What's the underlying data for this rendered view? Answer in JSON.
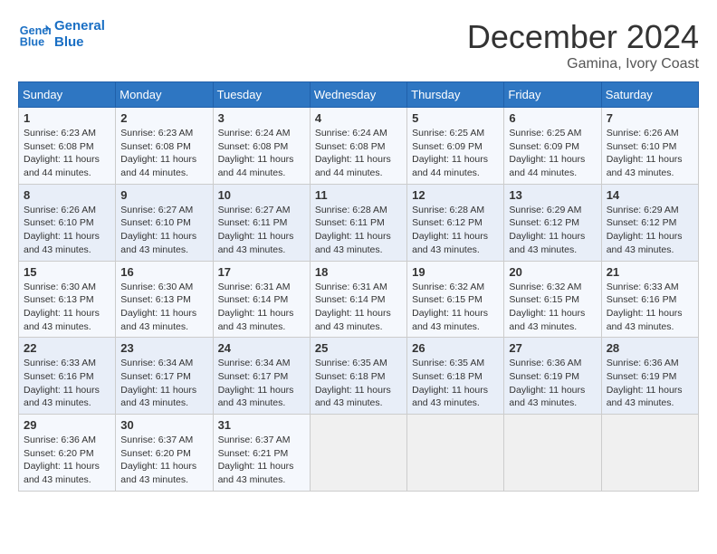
{
  "header": {
    "logo_line1": "General",
    "logo_line2": "Blue",
    "month_title": "December 2024",
    "subtitle": "Gamina, Ivory Coast"
  },
  "weekdays": [
    "Sunday",
    "Monday",
    "Tuesday",
    "Wednesday",
    "Thursday",
    "Friday",
    "Saturday"
  ],
  "weeks": [
    [
      {
        "day": 1,
        "sunrise": "6:23 AM",
        "sunset": "6:08 PM",
        "daylight": "11 hours and 44 minutes."
      },
      {
        "day": 2,
        "sunrise": "6:23 AM",
        "sunset": "6:08 PM",
        "daylight": "11 hours and 44 minutes."
      },
      {
        "day": 3,
        "sunrise": "6:24 AM",
        "sunset": "6:08 PM",
        "daylight": "11 hours and 44 minutes."
      },
      {
        "day": 4,
        "sunrise": "6:24 AM",
        "sunset": "6:08 PM",
        "daylight": "11 hours and 44 minutes."
      },
      {
        "day": 5,
        "sunrise": "6:25 AM",
        "sunset": "6:09 PM",
        "daylight": "11 hours and 44 minutes."
      },
      {
        "day": 6,
        "sunrise": "6:25 AM",
        "sunset": "6:09 PM",
        "daylight": "11 hours and 44 minutes."
      },
      {
        "day": 7,
        "sunrise": "6:26 AM",
        "sunset": "6:10 PM",
        "daylight": "11 hours and 43 minutes."
      }
    ],
    [
      {
        "day": 8,
        "sunrise": "6:26 AM",
        "sunset": "6:10 PM",
        "daylight": "11 hours and 43 minutes."
      },
      {
        "day": 9,
        "sunrise": "6:27 AM",
        "sunset": "6:10 PM",
        "daylight": "11 hours and 43 minutes."
      },
      {
        "day": 10,
        "sunrise": "6:27 AM",
        "sunset": "6:11 PM",
        "daylight": "11 hours and 43 minutes."
      },
      {
        "day": 11,
        "sunrise": "6:28 AM",
        "sunset": "6:11 PM",
        "daylight": "11 hours and 43 minutes."
      },
      {
        "day": 12,
        "sunrise": "6:28 AM",
        "sunset": "6:12 PM",
        "daylight": "11 hours and 43 minutes."
      },
      {
        "day": 13,
        "sunrise": "6:29 AM",
        "sunset": "6:12 PM",
        "daylight": "11 hours and 43 minutes."
      },
      {
        "day": 14,
        "sunrise": "6:29 AM",
        "sunset": "6:12 PM",
        "daylight": "11 hours and 43 minutes."
      }
    ],
    [
      {
        "day": 15,
        "sunrise": "6:30 AM",
        "sunset": "6:13 PM",
        "daylight": "11 hours and 43 minutes."
      },
      {
        "day": 16,
        "sunrise": "6:30 AM",
        "sunset": "6:13 PM",
        "daylight": "11 hours and 43 minutes."
      },
      {
        "day": 17,
        "sunrise": "6:31 AM",
        "sunset": "6:14 PM",
        "daylight": "11 hours and 43 minutes."
      },
      {
        "day": 18,
        "sunrise": "6:31 AM",
        "sunset": "6:14 PM",
        "daylight": "11 hours and 43 minutes."
      },
      {
        "day": 19,
        "sunrise": "6:32 AM",
        "sunset": "6:15 PM",
        "daylight": "11 hours and 43 minutes."
      },
      {
        "day": 20,
        "sunrise": "6:32 AM",
        "sunset": "6:15 PM",
        "daylight": "11 hours and 43 minutes."
      },
      {
        "day": 21,
        "sunrise": "6:33 AM",
        "sunset": "6:16 PM",
        "daylight": "11 hours and 43 minutes."
      }
    ],
    [
      {
        "day": 22,
        "sunrise": "6:33 AM",
        "sunset": "6:16 PM",
        "daylight": "11 hours and 43 minutes."
      },
      {
        "day": 23,
        "sunrise": "6:34 AM",
        "sunset": "6:17 PM",
        "daylight": "11 hours and 43 minutes."
      },
      {
        "day": 24,
        "sunrise": "6:34 AM",
        "sunset": "6:17 PM",
        "daylight": "11 hours and 43 minutes."
      },
      {
        "day": 25,
        "sunrise": "6:35 AM",
        "sunset": "6:18 PM",
        "daylight": "11 hours and 43 minutes."
      },
      {
        "day": 26,
        "sunrise": "6:35 AM",
        "sunset": "6:18 PM",
        "daylight": "11 hours and 43 minutes."
      },
      {
        "day": 27,
        "sunrise": "6:36 AM",
        "sunset": "6:19 PM",
        "daylight": "11 hours and 43 minutes."
      },
      {
        "day": 28,
        "sunrise": "6:36 AM",
        "sunset": "6:19 PM",
        "daylight": "11 hours and 43 minutes."
      }
    ],
    [
      {
        "day": 29,
        "sunrise": "6:36 AM",
        "sunset": "6:20 PM",
        "daylight": "11 hours and 43 minutes."
      },
      {
        "day": 30,
        "sunrise": "6:37 AM",
        "sunset": "6:20 PM",
        "daylight": "11 hours and 43 minutes."
      },
      {
        "day": 31,
        "sunrise": "6:37 AM",
        "sunset": "6:21 PM",
        "daylight": "11 hours and 43 minutes."
      },
      null,
      null,
      null,
      null
    ]
  ]
}
